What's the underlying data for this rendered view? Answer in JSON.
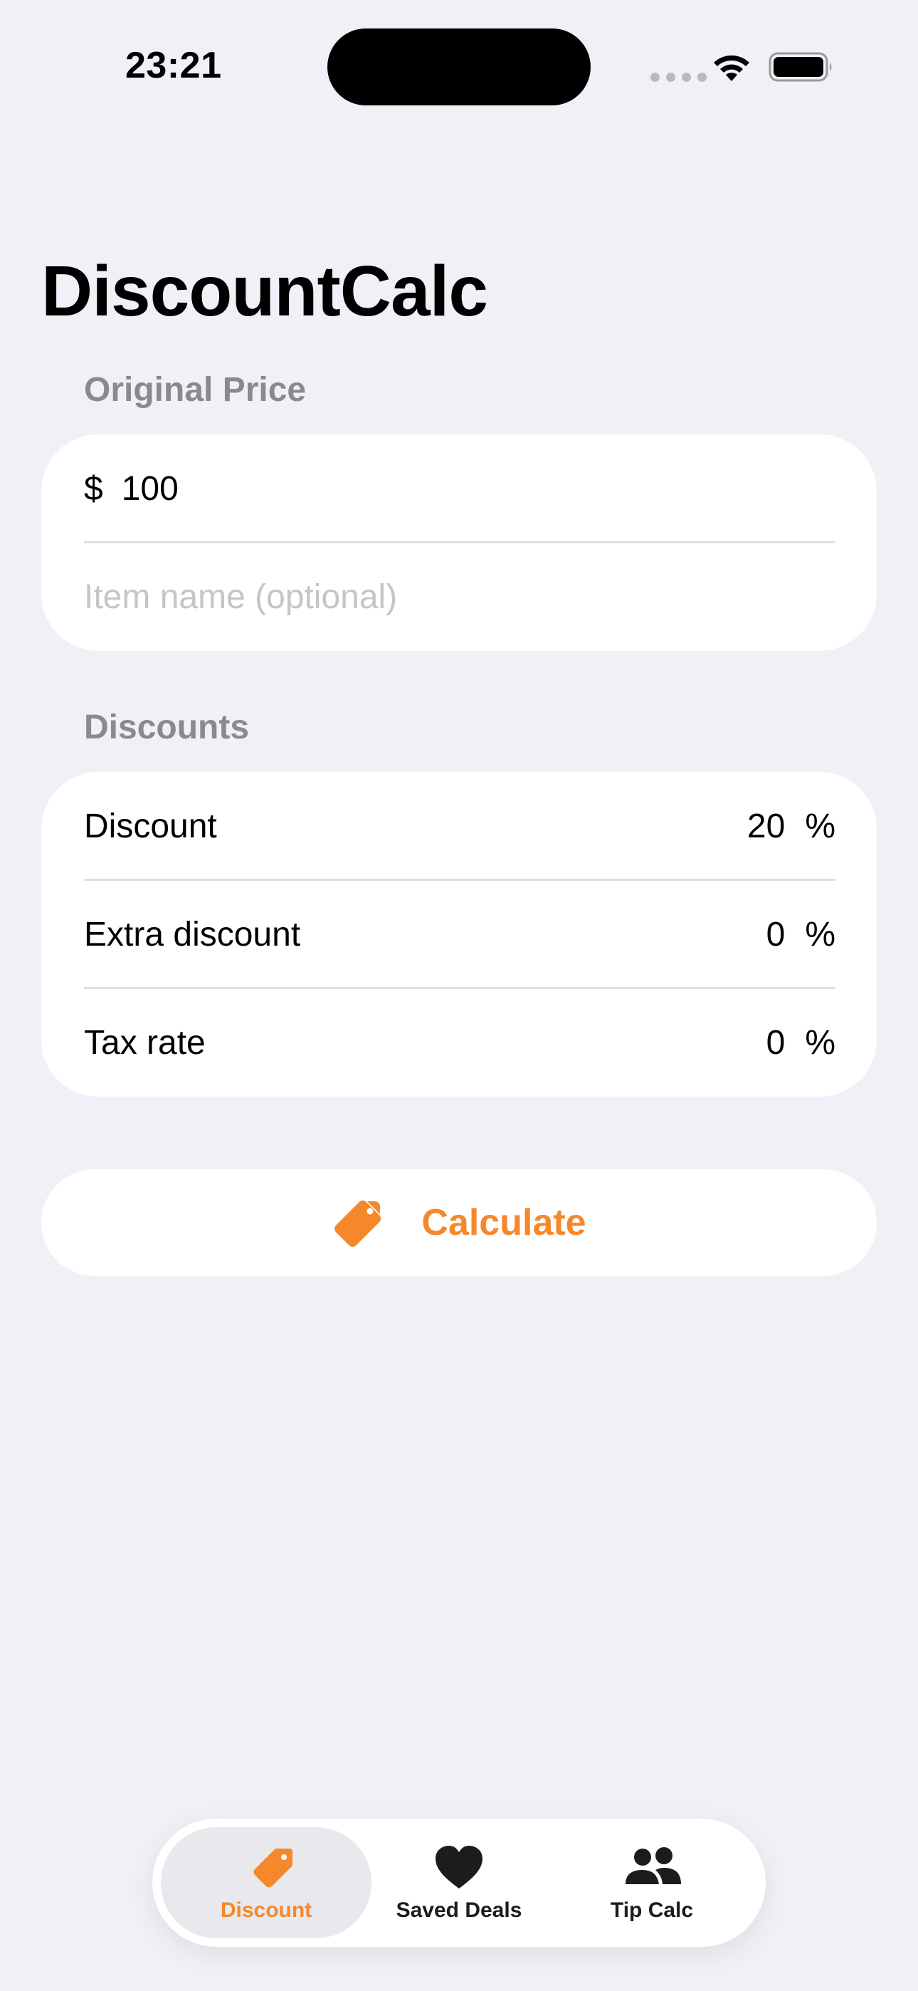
{
  "status_bar": {
    "time": "23:21"
  },
  "app": {
    "title": "DiscountCalc"
  },
  "price_section": {
    "label": "Original Price",
    "currency_symbol": "$",
    "price_value": "100",
    "item_name_value": "",
    "item_name_placeholder": "Item name (optional)"
  },
  "discounts_section": {
    "label": "Discounts",
    "rows": [
      {
        "label": "Discount",
        "value": "20",
        "unit": "%"
      },
      {
        "label": "Extra discount",
        "value": "0",
        "unit": "%"
      },
      {
        "label": "Tax rate",
        "value": "0",
        "unit": "%"
      }
    ]
  },
  "calculate_button": {
    "label": "Calculate",
    "icon": "tag-icon"
  },
  "tab_bar": {
    "tabs": [
      {
        "label": "Discount",
        "icon": "tag-icon",
        "active": true
      },
      {
        "label": "Saved Deals",
        "icon": "heart-icon",
        "active": false
      },
      {
        "label": "Tip Calc",
        "icon": "people-icon",
        "active": false
      }
    ]
  },
  "colors": {
    "accent": "#f5882a",
    "background": "#f1f0f6",
    "secondary_text": "#8a8a8e"
  }
}
